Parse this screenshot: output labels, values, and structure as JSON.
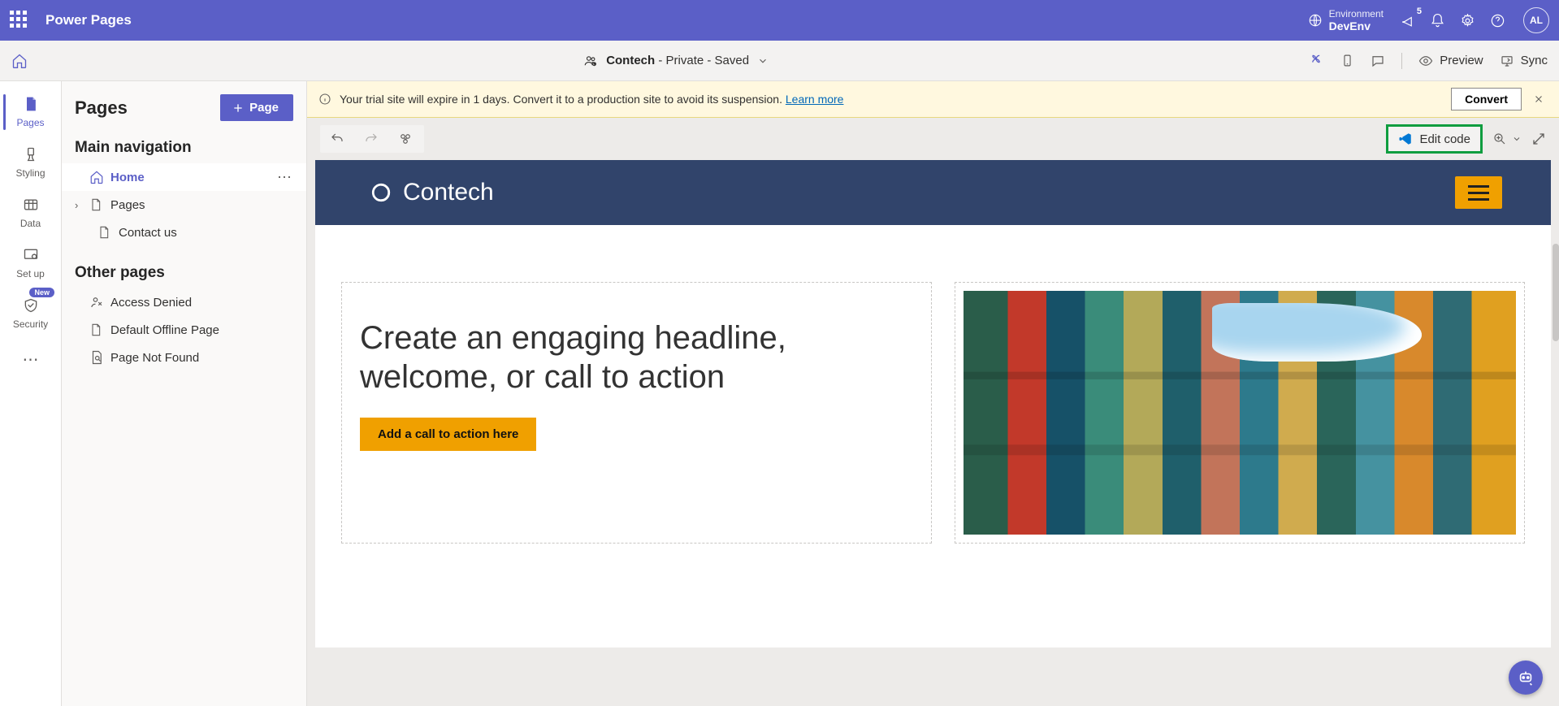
{
  "topbar": {
    "brand": "Power Pages",
    "env_label": "Environment",
    "env_value": "DevEnv",
    "notif_count": "5",
    "avatar": "AL"
  },
  "secbar": {
    "site_name": "Contech",
    "site_suffix": " - Private - Saved",
    "preview": "Preview",
    "sync": "Sync"
  },
  "rail": {
    "items": [
      {
        "label": "Pages",
        "active": true
      },
      {
        "label": "Styling"
      },
      {
        "label": "Data"
      },
      {
        "label": "Set up"
      },
      {
        "label": "Security",
        "badge": "New"
      }
    ]
  },
  "panel": {
    "title": "Pages",
    "add_button": "Page",
    "section_main": "Main navigation",
    "section_other": "Other pages",
    "main_items": [
      {
        "label": "Home",
        "active": true
      },
      {
        "label": "Pages",
        "expandable": true
      },
      {
        "label": "Contact us",
        "child": true
      }
    ],
    "other_items": [
      {
        "label": "Access Denied"
      },
      {
        "label": "Default Offline Page"
      },
      {
        "label": "Page Not Found"
      }
    ]
  },
  "banner": {
    "message": "Your trial site will expire in 1 days. Convert it to a production site to avoid its suspension. ",
    "link": "Learn more",
    "convert": "Convert"
  },
  "toolbar": {
    "edit_code": "Edit code"
  },
  "preview": {
    "site_name": "Contech",
    "headline": "Create an engaging headline, welcome, or call to action",
    "cta": "Add a call to action here"
  }
}
